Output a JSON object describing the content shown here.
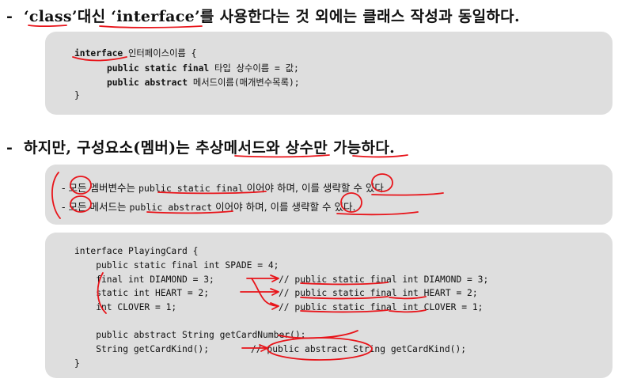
{
  "heading1": {
    "dash": "-",
    "text": "‘class’대신 ‘interface’를 사용한다는 것 외에는 클래스 작성과 동일하다."
  },
  "syntax_box": {
    "line1_kw": "interface",
    "line1_rest": " 인터페이스이름 {",
    "line2_kw": "public static final",
    "line2_rest": " 타입 상수이름 = 값;",
    "line3_kw": "public abstract",
    "line3_rest": " 메서드이름(매개변수목록);",
    "line4": "}"
  },
  "heading2": {
    "dash": "-",
    "text": "하지만, 구성요소(멤버)는 추상메서드와 상수만 가능하다."
  },
  "rules_box": {
    "rule1_prefix": "- 모든 멤버변수는 ",
    "rule1_code": "public static final",
    "rule1_suffix": " 이어야 하며, 이를 생략할 수 있다.",
    "rule2_prefix": "- 모든 메서드는 ",
    "rule2_code": "public abstract",
    "rule2_suffix": " 이어야 하며, 이를 생략할 수 있다."
  },
  "example_box": {
    "lines": [
      "interface PlayingCard {",
      "    public static final int SPADE = 4;",
      "    final int DIAMOND = 3;",
      "    static int HEART = 2;",
      "    int CLOVER = 1;",
      "",
      "    public abstract String getCardNumber();",
      "    String getCardKind();",
      "}"
    ],
    "notes": [
      "// public static final int DIAMOND = 3;",
      "// public static final int HEART = 2;",
      "// public static final int CLOVER = 1;",
      "// public abstract String getCardKind();"
    ]
  },
  "colors": {
    "ink": "#e8141a",
    "box": "#dedede"
  }
}
